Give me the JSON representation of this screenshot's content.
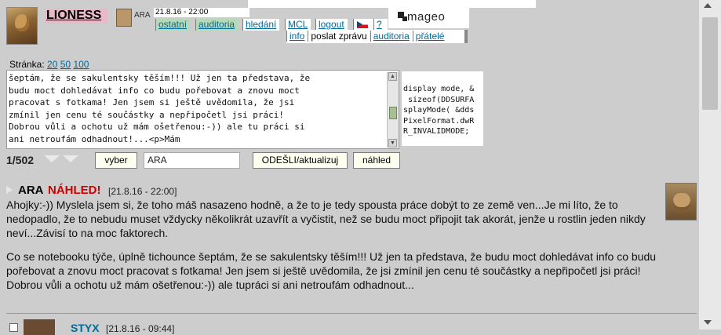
{
  "header": {
    "username": "LIONESS",
    "mini_user": "ARA",
    "date": "21.8.16 - 22:00",
    "logo_text": "mageo",
    "nav": [
      "ostatní",
      "auditoria",
      "hledání",
      "MCL",
      "logout"
    ],
    "help": "?",
    "subnav": [
      "info",
      "poslat zprávu",
      "auditoria",
      "přátelé"
    ]
  },
  "pager": {
    "label": "Stránka:",
    "pages": [
      "20",
      "50",
      "100"
    ]
  },
  "editor": {
    "text": "šeptám, že se sakulentsky těším!!! Už jen ta představa, že\nbudu moct dohledávat info co budu pořebovat a znovu moct\npracovat s fotkama! Jen jsem si ještě uvědomila, že jsi\nzmínil jen cenu té součástky a nepřipočetl jsi práci!\nDobrou vůli a ochotu už mám ošetřenou:-)) ale tu práci si\nani netroufám odhadnout!...<p>Mám",
    "code": "display mode, &\n sizeof(DDSURFA\nsplayMode( &dds\nPixelFormat.dwR\nR_INVALIDMODE;"
  },
  "controls": {
    "counter": "1/502",
    "choose_button": "vyber",
    "recipient": "ARA",
    "send_button": "ODEŠLI/aktualizuj",
    "preview_button": "náhled"
  },
  "post": {
    "author": "ARA",
    "label": "NÁHLED!",
    "date": "[21.8.16 - 22:00]",
    "paragraphs": [
      "Ahojky:-)) Myslela jsem si, že toho máš nasazeno hodně, a že to je tedy spousta práce dobýt to ze země ven...Je mi líto, že to nedopadlo, že to nebudu muset vždycky několikrát uzavřít a vyčistit, než se budu moct připojit tak akorát, jenže u rostlin jeden nikdy neví...Závisí to na moc faktorech.",
      "Co se notebooku týče, úplně tichounce šeptám, že se sakulentsky těším!!! Už jen ta představa, že budu moct dohledávat info co budu pořebovat a znovu moct pracovat s fotkama! Jen jsem si ještě uvědomila, že jsi zmínil jen cenu té součástky a nepřipočetl jsi práci! Dobrou vůli a ochotu už mám ošetřenou:-)) ale tupráci si ani netroufám odhadnout..."
    ]
  },
  "next_post": {
    "author": "STYX",
    "date": "[21.8.16 - 09:44]"
  }
}
